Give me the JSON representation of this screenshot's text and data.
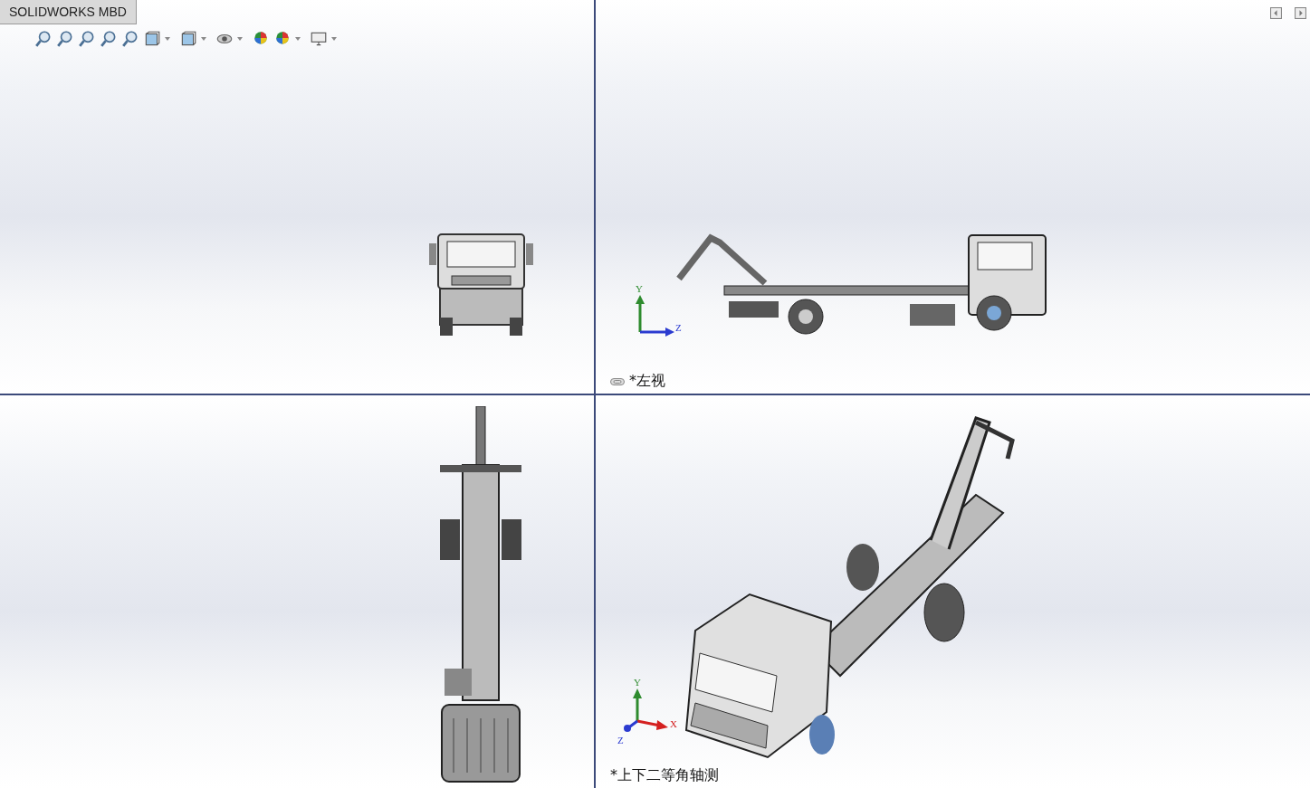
{
  "tab": {
    "label": "SOLIDWORKS MBD"
  },
  "viewports": [
    {
      "kind": "front"
    },
    {
      "kind": "side",
      "linked": true,
      "label": "*左视",
      "triad": {
        "kind": "side",
        "labels": [
          "Y",
          "Z"
        ]
      }
    },
    {
      "kind": "top"
    },
    {
      "kind": "iso",
      "linked": false,
      "label": "*上下二等角轴测",
      "triad": {
        "kind": "iso",
        "labels": [
          "Y",
          "X",
          "Z"
        ]
      }
    }
  ]
}
